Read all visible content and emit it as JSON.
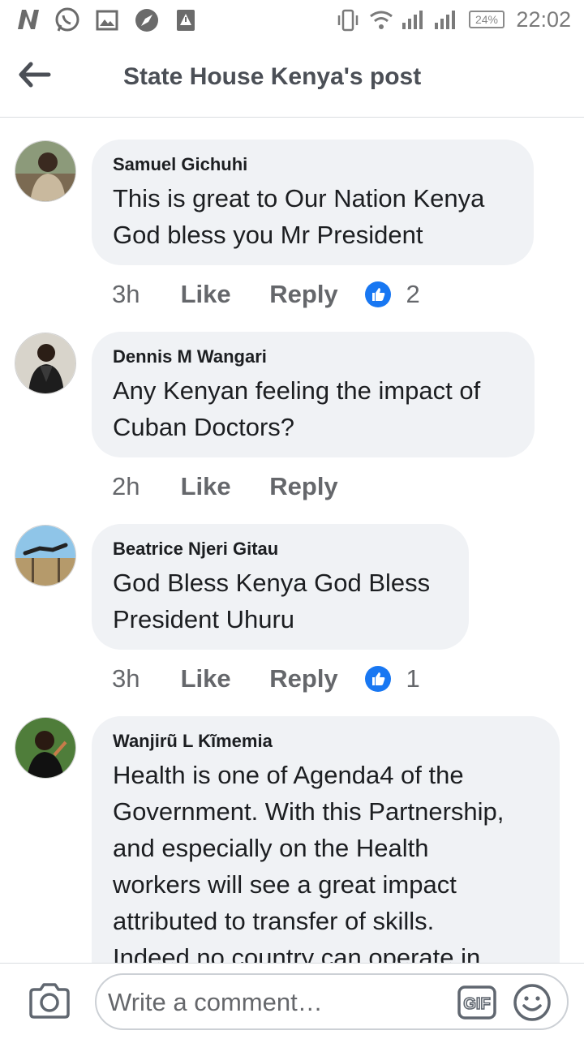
{
  "status_bar": {
    "time": "22:02",
    "battery": "24%"
  },
  "header": {
    "title": "State House Kenya's post"
  },
  "comments": [
    {
      "author": "Samuel Gichuhi",
      "lines": [
        "This is great to Our Nation Kenya",
        "God bless you Mr President"
      ],
      "time": "3h",
      "like": "Like",
      "reply": "Reply",
      "reactions": "2"
    },
    {
      "author": "Dennis M Wangari",
      "lines": [
        "Any Kenyan feeling the impact of",
        "Cuban Doctors?"
      ],
      "time": "2h",
      "like": "Like",
      "reply": "Reply"
    },
    {
      "author": "Beatrice Njeri Gitau",
      "lines": [
        "God Bless Kenya God Bless",
        "President Uhuru"
      ],
      "time": "3h",
      "like": "Like",
      "reply": "Reply",
      "reactions": "1"
    },
    {
      "author": "Wanjirũ L Kĩmemia",
      "lines": [
        "Health is one of Agenda4 of the",
        "Government. With this Partnership,",
        "and especially on the Health",
        "workers will see a great impact",
        "attributed to transfer of skills.",
        "Indeed no country can operate in"
      ]
    }
  ],
  "composer": {
    "placeholder": "Write a comment…"
  },
  "icons": {
    "status": [
      "n-app-icon",
      "whatsapp-icon",
      "gallery-icon",
      "compass-icon",
      "alert-icon",
      "vibrate-icon",
      "wifi-icon",
      "signal-icon",
      "signal-icon"
    ],
    "back": "back-arrow-icon",
    "reaction": "like-reaction-icon",
    "camera": "camera-icon",
    "gif": "gif-icon",
    "emoji": "emoji-icon"
  },
  "colors": {
    "like_blue": "#1877f2",
    "bubble": "#f0f2f5",
    "header_text": "#4b4f56",
    "meta_text": "#65676b"
  }
}
